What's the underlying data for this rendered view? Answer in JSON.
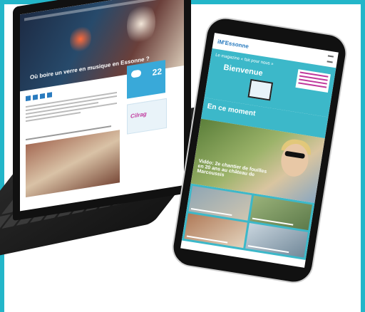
{
  "laptop": {
    "article_title": "Où boire un verre en musique en Essonne ?",
    "weather_temperature": "22",
    "ad_text": "Cilrag"
  },
  "phone": {
    "logo": "iM'Essonne",
    "banner_tagline": "Le magazine « fait pour nous »",
    "banner_title": "Bienvenue",
    "section_title": "En ce moment",
    "feature_caption": "Vidéo: 2e chantier de fouilles en 20 ans au château de Marcoussis"
  },
  "colors": {
    "accent": "#23b6c9",
    "banner": "#3cb8c9",
    "menu_text": "#c0399d"
  }
}
